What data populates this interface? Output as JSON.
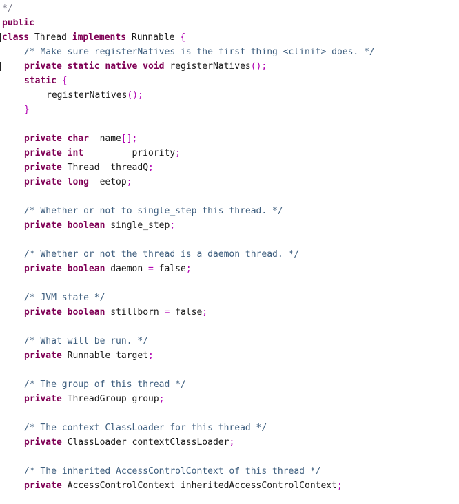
{
  "editor": {
    "language": "Java",
    "colors": {
      "keyword": "#7f0055",
      "comment": "#3f5f7f",
      "punctuation": "#b000b0",
      "text": "#1a1a1a",
      "background": "#ffffff"
    },
    "lines": [
      {
        "indent": 0,
        "tokens": [
          {
            "t": "cut",
            "v": "*/"
          }
        ]
      },
      {
        "indent": 0,
        "tokens": [
          {
            "t": "kw",
            "v": "public"
          }
        ]
      },
      {
        "indent": 0,
        "tokens": [
          {
            "t": "kw",
            "v": "class"
          },
          {
            "t": "tx",
            "v": " Thread "
          },
          {
            "t": "kw",
            "v": "implements"
          },
          {
            "t": "tx",
            "v": " Runnable "
          },
          {
            "t": "pn",
            "v": "{"
          }
        ]
      },
      {
        "indent": 1,
        "tokens": [
          {
            "t": "cm",
            "v": "/* Make sure registerNatives is the first thing <clinit> does. */"
          }
        ]
      },
      {
        "indent": 1,
        "tokens": [
          {
            "t": "kw",
            "v": "private static native void"
          },
          {
            "t": "tx",
            "v": " registerNatives"
          },
          {
            "t": "pn",
            "v": "();"
          }
        ]
      },
      {
        "indent": 1,
        "tokens": [
          {
            "t": "kw",
            "v": "static"
          },
          {
            "t": "tx",
            "v": " "
          },
          {
            "t": "pn",
            "v": "{"
          }
        ]
      },
      {
        "indent": 2,
        "tokens": [
          {
            "t": "tx",
            "v": "registerNatives"
          },
          {
            "t": "pn",
            "v": "();"
          }
        ]
      },
      {
        "indent": 1,
        "tokens": [
          {
            "t": "pn",
            "v": "}"
          }
        ]
      },
      {
        "indent": 0,
        "tokens": []
      },
      {
        "indent": 1,
        "tokens": [
          {
            "t": "kw",
            "v": "private char"
          },
          {
            "t": "tx",
            "v": "  name"
          },
          {
            "t": "pn",
            "v": "[];"
          }
        ]
      },
      {
        "indent": 1,
        "tokens": [
          {
            "t": "kw",
            "v": "private int"
          },
          {
            "t": "tx",
            "v": "         priority"
          },
          {
            "t": "pn",
            "v": ";"
          }
        ]
      },
      {
        "indent": 1,
        "tokens": [
          {
            "t": "kw",
            "v": "private"
          },
          {
            "t": "tx",
            "v": " Thread  threadQ"
          },
          {
            "t": "pn",
            "v": ";"
          }
        ]
      },
      {
        "indent": 1,
        "tokens": [
          {
            "t": "kw",
            "v": "private long"
          },
          {
            "t": "tx",
            "v": "  eetop"
          },
          {
            "t": "pn",
            "v": ";"
          }
        ]
      },
      {
        "indent": 0,
        "tokens": []
      },
      {
        "indent": 1,
        "tokens": [
          {
            "t": "cm",
            "v": "/* Whether or not to single_step this thread. */"
          }
        ]
      },
      {
        "indent": 1,
        "tokens": [
          {
            "t": "kw",
            "v": "private boolean"
          },
          {
            "t": "tx",
            "v": " single_step"
          },
          {
            "t": "pn",
            "v": ";"
          }
        ]
      },
      {
        "indent": 0,
        "tokens": []
      },
      {
        "indent": 1,
        "tokens": [
          {
            "t": "cm",
            "v": "/* Whether or not the thread is a daemon thread. */"
          }
        ]
      },
      {
        "indent": 1,
        "tokens": [
          {
            "t": "kw",
            "v": "private boolean"
          },
          {
            "t": "tx",
            "v": " daemon "
          },
          {
            "t": "pn",
            "v": "="
          },
          {
            "t": "tx",
            "v": " false"
          },
          {
            "t": "pn",
            "v": ";"
          }
        ]
      },
      {
        "indent": 0,
        "tokens": []
      },
      {
        "indent": 1,
        "tokens": [
          {
            "t": "cm",
            "v": "/* JVM state */"
          }
        ]
      },
      {
        "indent": 1,
        "tokens": [
          {
            "t": "kw",
            "v": "private boolean"
          },
          {
            "t": "tx",
            "v": " stillborn "
          },
          {
            "t": "pn",
            "v": "="
          },
          {
            "t": "tx",
            "v": " false"
          },
          {
            "t": "pn",
            "v": ";"
          }
        ]
      },
      {
        "indent": 0,
        "tokens": []
      },
      {
        "indent": 1,
        "tokens": [
          {
            "t": "cm",
            "v": "/* What will be run. */"
          }
        ]
      },
      {
        "indent": 1,
        "tokens": [
          {
            "t": "kw",
            "v": "private"
          },
          {
            "t": "tx",
            "v": " Runnable target"
          },
          {
            "t": "pn",
            "v": ";"
          }
        ]
      },
      {
        "indent": 0,
        "tokens": []
      },
      {
        "indent": 1,
        "tokens": [
          {
            "t": "cm",
            "v": "/* The group of this thread */"
          }
        ]
      },
      {
        "indent": 1,
        "tokens": [
          {
            "t": "kw",
            "v": "private"
          },
          {
            "t": "tx",
            "v": " ThreadGroup group"
          },
          {
            "t": "pn",
            "v": ";"
          }
        ]
      },
      {
        "indent": 0,
        "tokens": []
      },
      {
        "indent": 1,
        "tokens": [
          {
            "t": "cm",
            "v": "/* The context ClassLoader for this thread */"
          }
        ]
      },
      {
        "indent": 1,
        "tokens": [
          {
            "t": "kw",
            "v": "private"
          },
          {
            "t": "tx",
            "v": " ClassLoader contextClassLoader"
          },
          {
            "t": "pn",
            "v": ";"
          }
        ]
      },
      {
        "indent": 0,
        "tokens": []
      },
      {
        "indent": 1,
        "tokens": [
          {
            "t": "cm",
            "v": "/* The inherited AccessControlContext of this thread */"
          }
        ]
      },
      {
        "indent": 1,
        "tokens": [
          {
            "t": "kw",
            "v": "private"
          },
          {
            "t": "tx",
            "v": " AccessControlContext inheritedAccessControlContext"
          },
          {
            "t": "pn",
            "v": ";"
          }
        ]
      }
    ]
  }
}
